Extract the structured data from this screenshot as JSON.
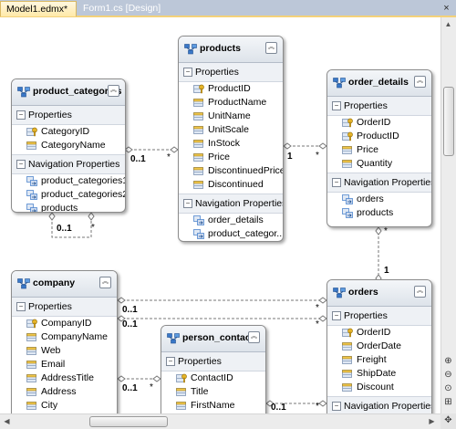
{
  "tabs": [
    {
      "label": "Model1.edmx*",
      "active": true
    },
    {
      "label": "Form1.cs [Design]",
      "active": false
    }
  ],
  "tab_close_glyph": "×",
  "entity_icon": "entity-type-icon",
  "key_icon": "key-property-icon",
  "prop_icon": "scalar-property-icon",
  "nav_icon": "navigation-property-icon",
  "section_labels": {
    "properties": "Properties",
    "navigation": "Navigation Properties"
  },
  "entities": {
    "product_categories": {
      "title": "product_categories",
      "properties": [
        {
          "name": "CategoryID",
          "key": true
        },
        {
          "name": "CategoryName",
          "key": false
        }
      ],
      "navigation": [
        "product_categories1",
        "product_categories2",
        "products"
      ]
    },
    "products": {
      "title": "products",
      "properties": [
        {
          "name": "ProductID",
          "key": true
        },
        {
          "name": "ProductName",
          "key": false
        },
        {
          "name": "UnitName",
          "key": false
        },
        {
          "name": "UnitScale",
          "key": false
        },
        {
          "name": "InStock",
          "key": false
        },
        {
          "name": "Price",
          "key": false
        },
        {
          "name": "DiscontinuedPrice",
          "key": false
        },
        {
          "name": "Discontinued",
          "key": false
        }
      ],
      "navigation": [
        "order_details",
        "product_categor..."
      ]
    },
    "order_details": {
      "title": "order_details",
      "properties": [
        {
          "name": "OrderID",
          "key": true
        },
        {
          "name": "ProductID",
          "key": true
        },
        {
          "name": "Price",
          "key": false
        },
        {
          "name": "Quantity",
          "key": false
        }
      ],
      "navigation": [
        "orders",
        "products"
      ]
    },
    "company": {
      "title": "company",
      "properties": [
        {
          "name": "CompanyID",
          "key": true
        },
        {
          "name": "CompanyName",
          "key": false
        },
        {
          "name": "Web",
          "key": false
        },
        {
          "name": "Email",
          "key": false
        },
        {
          "name": "AddressTitle",
          "key": false
        },
        {
          "name": "Address",
          "key": false
        },
        {
          "name": "City",
          "key": false
        }
      ],
      "navigation": []
    },
    "person_contact": {
      "title": "person_contact",
      "properties": [
        {
          "name": "ContactID",
          "key": true
        },
        {
          "name": "Title",
          "key": false
        },
        {
          "name": "FirstName",
          "key": false
        }
      ],
      "navigation": []
    },
    "orders": {
      "title": "orders",
      "properties": [
        {
          "name": "OrderID",
          "key": true
        },
        {
          "name": "OrderDate",
          "key": false
        },
        {
          "name": "Freight",
          "key": false
        },
        {
          "name": "ShipDate",
          "key": false
        },
        {
          "name": "Discount",
          "key": false
        }
      ],
      "navigation": []
    }
  },
  "multiplicities": {
    "self_zero_one": "0..1",
    "self_many": "*",
    "cat_prod_one": "0..1",
    "cat_prod_many": "*",
    "prod_od_one": "1",
    "prod_od_many": "*",
    "od_ord_many": "*",
    "od_ord_one": "1",
    "comp_ord_one": "0..1",
    "comp_ord_many": "*",
    "comp_ord2_one": "0..1",
    "comp_ord2_many": "*",
    "comp_pc_one": "0..1",
    "comp_pc_many": "*",
    "pc_ord_one": "0..1",
    "pc_ord_many": "*"
  },
  "zoom_tools": [
    "⊕",
    "⊖",
    "⊙",
    "⊞"
  ],
  "colors": {
    "tab_bar": "#bcc7d8",
    "active_tab": "#ffe9a8",
    "key_gold": "#d6a21e",
    "entity_icon_blue": "#3a78c8"
  }
}
